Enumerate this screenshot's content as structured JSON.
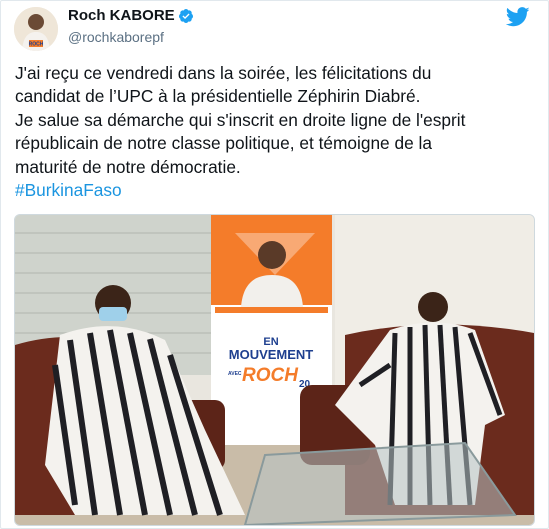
{
  "author": {
    "display_name": "Roch KABORE",
    "handle": "@rochkaborepf",
    "avatar_icon": "profile-avatar",
    "verified_icon": "verified-badge-icon"
  },
  "platform_icon": "twitter-bird-icon",
  "tweet": {
    "lines": [
      "J'ai reçu ce vendredi dans la soirée, les félicitations du",
      "candidat de l’UPC à la présidentielle Zéphirin Diabré.",
      "Je salue sa démarche qui s'inscrit en droite ligne de l'esprit",
      "républicain de notre classe politique, et témoigne de la",
      "maturité de notre démocratie."
    ],
    "hashtag": "#BurkinaFaso"
  },
  "photo": {
    "banner_line1": "EN",
    "banner_line2": "MOUVEMENT",
    "banner_small": "AVEC",
    "banner_name": "ROCH",
    "banner_year": "20"
  },
  "colors": {
    "link": "#1b95e0",
    "verified": "#1da1f2",
    "banner_orange": "#f47c2a",
    "banner_blue": "#1e3f8f"
  }
}
